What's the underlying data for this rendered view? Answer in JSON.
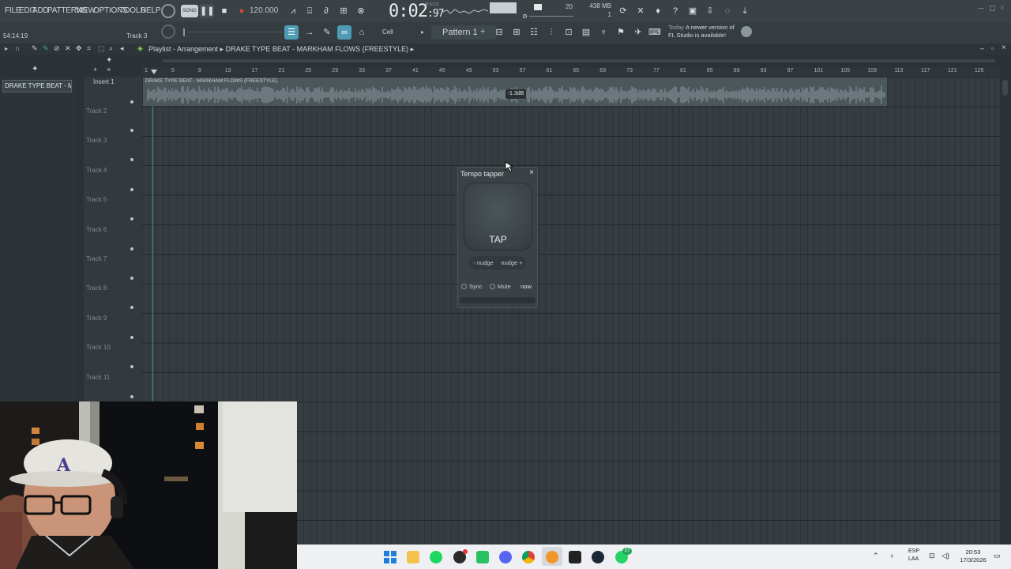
{
  "menu": [
    "FILE",
    "EDIT",
    "ADD",
    "PATTERNS",
    "VIEW",
    "OPTIONS",
    "TOOLS",
    "HELP"
  ],
  "transport": {
    "mode_label": "SONG",
    "tempo": "120.000",
    "time_main": "0:02",
    "time_frac": "97",
    "time_unit": "M:S:CS"
  },
  "system": {
    "cpu": "20",
    "memory": "438 MB",
    "polyphony": "1"
  },
  "hint_bar": {
    "time": "54:14:19",
    "track": "Track 3"
  },
  "toolbar": {
    "snap": "Cell",
    "pattern": "Pattern 1"
  },
  "notice": {
    "today": "Today",
    "line1": "A newer version of",
    "line2": "FL Studio is available!"
  },
  "playlist": {
    "title": "Playlist - Arrangement",
    "breadcrumb": "DRAKE TYPE BEAT - MARKHAM FLOWS (FREESTYLE)",
    "pattern_item": "DRAKE TYPE BEAT - M...",
    "insert": "Insert 1",
    "clip_title": "DRAKE TYPE BEAT - MARKHAM FLOWS (FREESTYLE)",
    "gain_badge": "-1.3dB",
    "ruler_ticks": [
      "1",
      "5",
      "9",
      "13",
      "17",
      "21",
      "25",
      "29",
      "33",
      "37",
      "41",
      "45",
      "49",
      "53",
      "57",
      "61",
      "65",
      "69",
      "73",
      "77",
      "81",
      "85",
      "89",
      "93",
      "97",
      "101",
      "105",
      "109",
      "113",
      "117",
      "121",
      "125"
    ],
    "tracks": [
      "Track 2",
      "Track 3",
      "Track 4",
      "Track 5",
      "Track 6",
      "Track 7",
      "Track 8",
      "Track 9",
      "Track 10",
      "Track 11"
    ]
  },
  "tempo_tapper": {
    "title": "Tempo tapper",
    "close": "×",
    "tap": "TAP",
    "nudge_minus": "- nudge",
    "nudge_plus": "nudge +",
    "sync": "Sync",
    "mute": "Mute",
    "now": "now"
  },
  "taskbar": {
    "lang1": "ESP",
    "lang2": "LAA",
    "time": "20:53",
    "date": "17/3/2026",
    "whatsapp_badge": "27"
  },
  "colors": {
    "accent": "#4f9bb5",
    "record": "#d9463e",
    "grid": "#363d41"
  }
}
